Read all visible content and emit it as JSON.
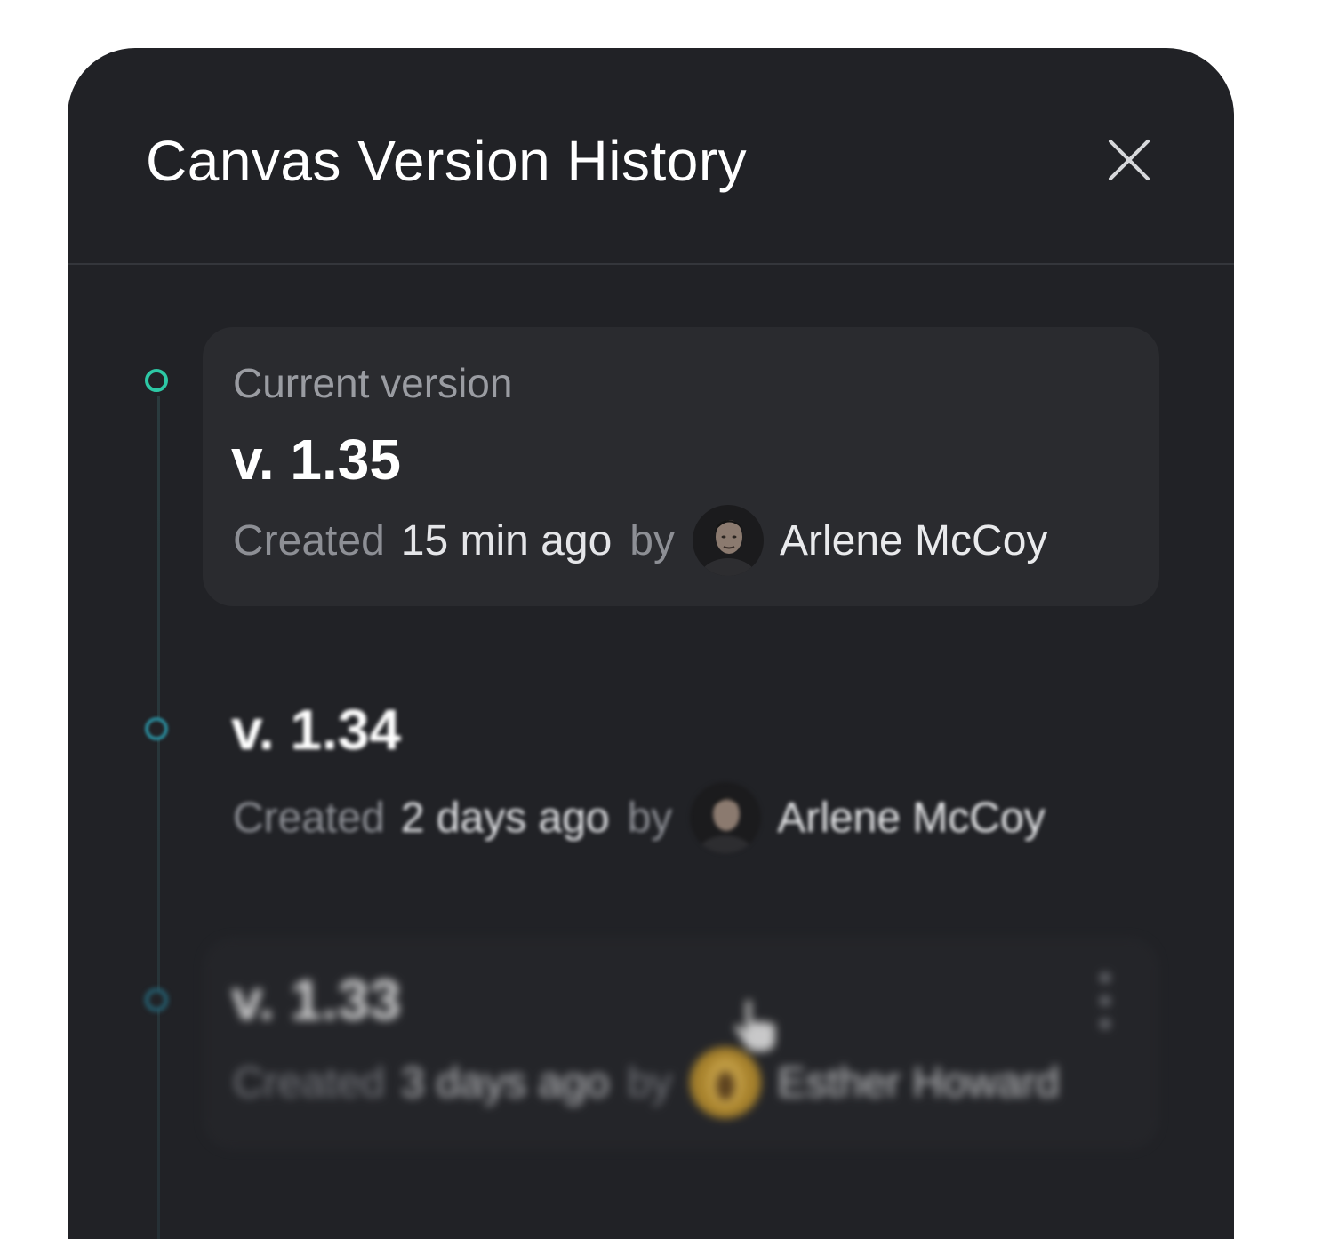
{
  "dialog": {
    "title": "Canvas Version History",
    "close_icon": "close-icon"
  },
  "colors": {
    "background": "#212226",
    "accent": "#2dc8a5",
    "card": "#2a2b2f"
  },
  "versions": [
    {
      "label": "Current version",
      "version": "v. 1.35",
      "created_prefix": "Created",
      "time": "15 min ago",
      "by": "by",
      "author": "Arlene McCoy",
      "avatar_icon": "avatar-photo"
    },
    {
      "version": "v. 1.34",
      "created_prefix": "Created",
      "time": "2 days ago",
      "by": "by",
      "author": "Arlene McCoy",
      "avatar_icon": "avatar-photo"
    },
    {
      "version": "v. 1.33",
      "created_prefix": "Created",
      "time": "3 days ago",
      "by": "by",
      "author": "Esther Howard",
      "avatar_icon": "avatar-photo",
      "menu_icon": "more-vertical-icon",
      "cursor_icon": "hand-pointer-icon"
    }
  ]
}
